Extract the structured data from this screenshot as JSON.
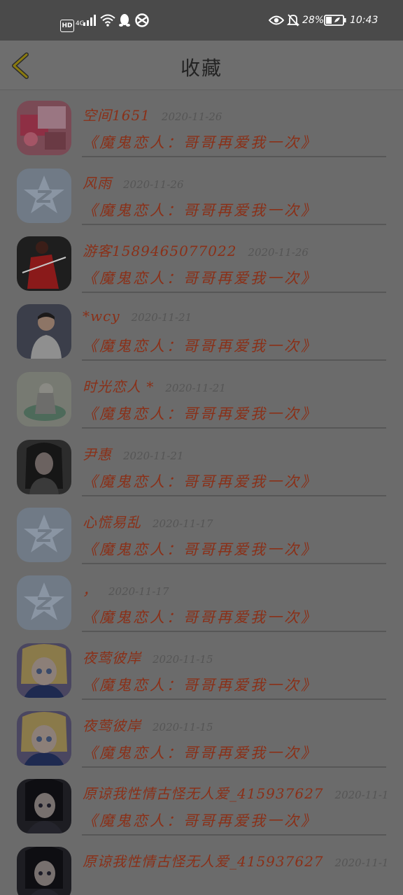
{
  "status_bar": {
    "hd": "HD",
    "network": "4G",
    "battery_text": "28%",
    "time": "10:43"
  },
  "header": {
    "title": "收藏"
  },
  "favorites": [
    {
      "username": "",
      "date": "",
      "story": "《魔鬼恋人：哥哥再爱我一次》",
      "avatar": "photo-pink"
    },
    {
      "username": "空间1651",
      "date": "2020-11-26",
      "story": "《魔鬼恋人：哥哥再爱我一次》",
      "avatar": "photo-pink"
    },
    {
      "username": "风雨",
      "date": "2020-11-26",
      "story": "《魔鬼恋人：哥哥再爱我一次》",
      "avatar": "default-star"
    },
    {
      "username": "游客1589465077022",
      "date": "2020-11-26",
      "story": "《魔鬼恋人：哥哥再爱我一次》",
      "avatar": "photo-red"
    },
    {
      "username": "*wcy",
      "date": "2020-11-21",
      "story": "《魔鬼恋人：哥哥再爱我一次》",
      "avatar": "photo-boy"
    },
    {
      "username": "时光恋人 *",
      "date": "2020-11-21",
      "story": "《魔鬼恋人：哥哥再爱我一次》",
      "avatar": "photo-green"
    },
    {
      "username": "尹惠",
      "date": "2020-11-21",
      "story": "《魔鬼恋人：哥哥再爱我一次》",
      "avatar": "photo-dark"
    },
    {
      "username": "心慌易乱",
      "date": "2020-11-17",
      "story": "《魔鬼恋人：哥哥再爱我一次》",
      "avatar": "default-star"
    },
    {
      "username": "，",
      "date": "2020-11-17",
      "story": "《魔鬼恋人：哥哥再爱我一次》",
      "avatar": "default-star"
    },
    {
      "username": "夜莺彼岸",
      "date": "2020-11-15",
      "story": "《魔鬼恋人：哥哥再爱我一次》",
      "avatar": "photo-anime"
    },
    {
      "username": "夜莺彼岸",
      "date": "2020-11-15",
      "story": "《魔鬼恋人：哥哥再爱我一次》",
      "avatar": "photo-anime"
    },
    {
      "username": "原谅我性情古怪无人爱_415937627",
      "date": "2020-11-1",
      "story": "《魔鬼恋人：哥哥再爱我一次》",
      "avatar": "photo-anime-dark"
    },
    {
      "username": "原谅我性情古怪无人爱_415937627",
      "date": "2020-11-1",
      "story": "",
      "avatar": "photo-anime-dark"
    }
  ]
}
